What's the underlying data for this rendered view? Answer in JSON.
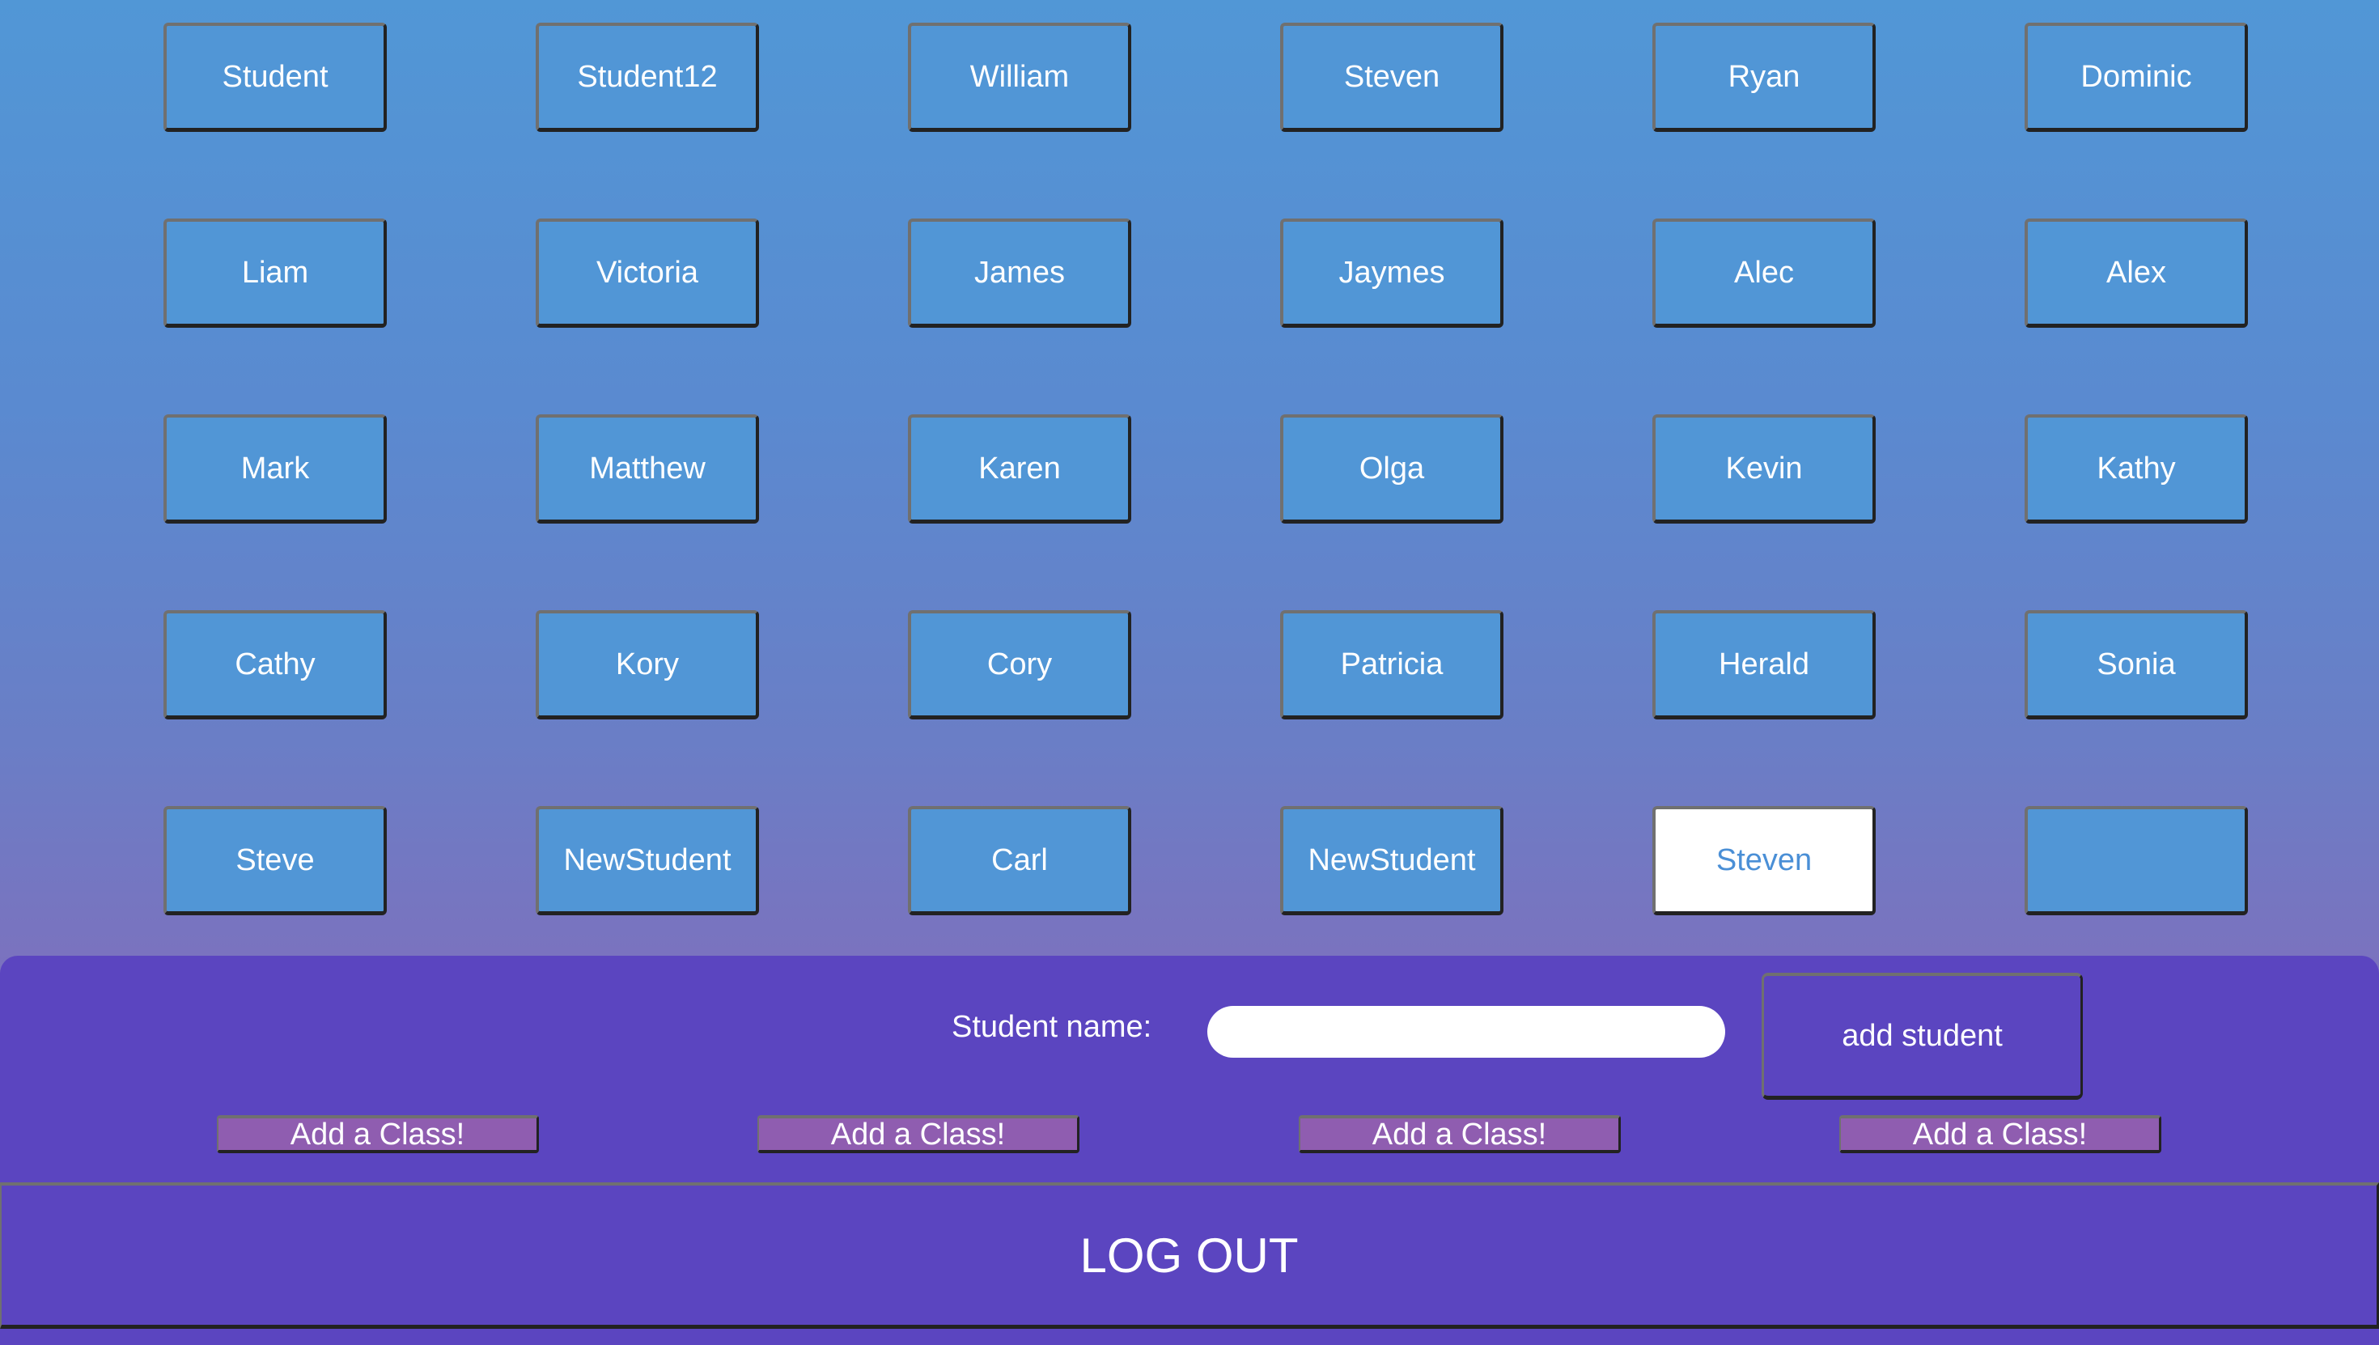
{
  "students": [
    "Student",
    "Student12",
    "William",
    "Steven",
    "Ryan",
    "Dominic",
    "Liam",
    "Victoria",
    "James",
    "Jaymes",
    "Alec",
    "Alex",
    "Mark",
    "Matthew",
    "Karen",
    "Olga",
    "Kevin",
    "Kathy",
    "Cathy",
    "Kory",
    "Cory",
    "Patricia",
    "Herald",
    "Sonia",
    "Steve",
    "NewStudent",
    "Carl",
    "NewStudent",
    "Steven",
    ""
  ],
  "selected_index": 28,
  "form": {
    "label": "Student name:",
    "input_value": "",
    "add_button": "add student"
  },
  "class_buttons": [
    "Add a Class!",
    "Add a Class!",
    "Add a Class!",
    "Add a Class!"
  ],
  "logout": "LOG OUT",
  "colors": {
    "button": "#5196d6",
    "panel": "#5b45c0",
    "class_button": "#8f5db0",
    "selected_text": "#4a8fd6"
  }
}
